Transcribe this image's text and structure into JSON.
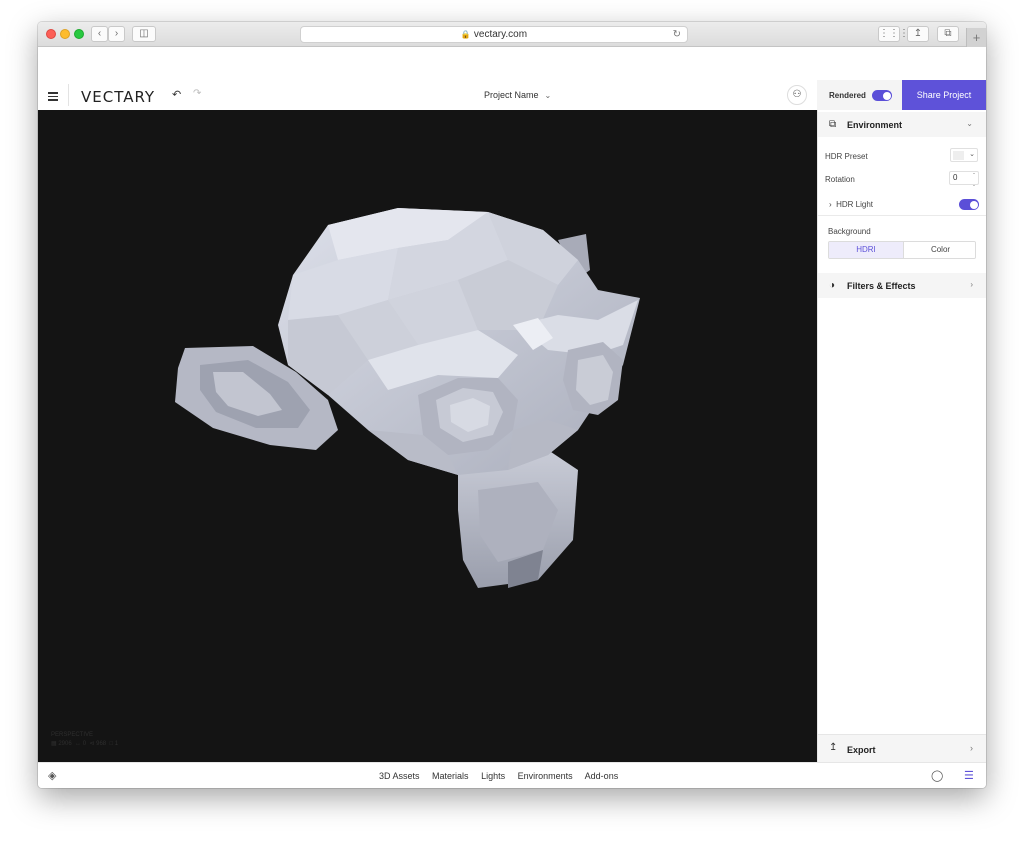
{
  "browser": {
    "url": "vectary.com",
    "back_icon": "chevron-left-icon",
    "forward_icon": "chevron-right-icon",
    "sidebar_icon": "sidebar-icon",
    "grid_icon": "grid-icon",
    "share_icon": "share-icon",
    "tabs_icon": "tabs-icon",
    "new_tab_label": "+"
  },
  "header": {
    "logo": "VECTARY",
    "project_name": "Project Name",
    "rendered_label": "Rendered",
    "rendered_on": true,
    "share_label": "Share Project"
  },
  "viewport": {
    "view_label": "PERSPECTIVE",
    "stats": [
      {
        "icon": "faces-icon",
        "value": "2906"
      },
      {
        "icon": "edges-icon",
        "value": "0"
      },
      {
        "icon": "vertices-icon",
        "value": "968"
      },
      {
        "icon": "objects-icon",
        "value": "1"
      }
    ]
  },
  "panel": {
    "environment": {
      "title": "Environment",
      "hdr_preset_label": "HDR Preset",
      "rotation_label": "Rotation",
      "rotation_value": "0",
      "hdr_light_label": "HDR Light",
      "hdr_light_on": true,
      "background_label": "Background",
      "background_options": [
        "HDRI",
        "Color"
      ],
      "background_selected": "HDRI"
    },
    "filters": {
      "title": "Filters & Effects"
    },
    "export": {
      "title": "Export"
    }
  },
  "bottom_nav": {
    "items": [
      "3D Assets",
      "Materials",
      "Lights",
      "Environments",
      "Add-ons"
    ]
  },
  "colors": {
    "accent": "#5e52d9",
    "viewport_bg": "#141414",
    "model": "#c8cbd6"
  }
}
